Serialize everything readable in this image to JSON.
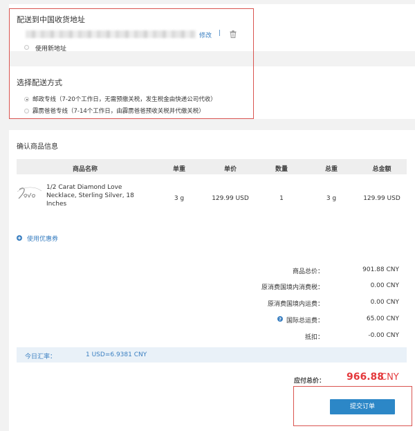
{
  "address": {
    "title": "配送到中国收货地址",
    "edit_label": "修改",
    "separator": "|",
    "trash_icon": "trash-icon",
    "new_address_label": "使用新地址"
  },
  "shipping": {
    "title": "选择配送方式",
    "options": [
      {
        "label": "邮政专线（7-20个工作日，无需预缴关税，发生税金由快递公司代收）",
        "selected": true
      },
      {
        "label": "霹雳爸爸专线（7-14个工作日，由霹雳爸爸预收关税并代缴关税）",
        "selected": false
      }
    ]
  },
  "products": {
    "title": "确认商品信息",
    "columns": [
      "商品名称",
      "单重",
      "单价",
      "数量",
      "总重",
      "总金额"
    ],
    "rows": [
      {
        "name_line1": "1/2 Carat Diamond Love",
        "name_line2": "Necklace, Sterling Silver, 18",
        "name_line3": "Inches",
        "unit_weight": "3 g",
        "unit_price": "129.99 USD",
        "quantity": "1",
        "total_weight": "3 g",
        "total_amount": "129.99 USD"
      }
    ]
  },
  "coupon": {
    "label": "使用优惠券"
  },
  "summary": {
    "goods_total_label": "商品总价：",
    "goods_total_value": "901.88 CNY",
    "consumption_tax_label": "原消费国境内消费税：",
    "consumption_tax_value": "0.00 CNY",
    "domestic_shipping_label": "原消费国境内运费：",
    "domestic_shipping_value": "0.00 CNY",
    "intl_shipping_label": "国际总运费：",
    "intl_shipping_value": "65.00 CNY",
    "deduction_label": "抵扣：",
    "deduction_value": "-0.00 CNY"
  },
  "exchange_rate": {
    "label": "今日汇率：",
    "value": "1 USD=6.9381 CNY"
  },
  "payable": {
    "label": "应付总价：",
    "amount": "966.88",
    "currency": "CNY",
    "amount_color": "#e4393c"
  },
  "submit": {
    "label": "提交订单",
    "color": "#2c87c7"
  }
}
